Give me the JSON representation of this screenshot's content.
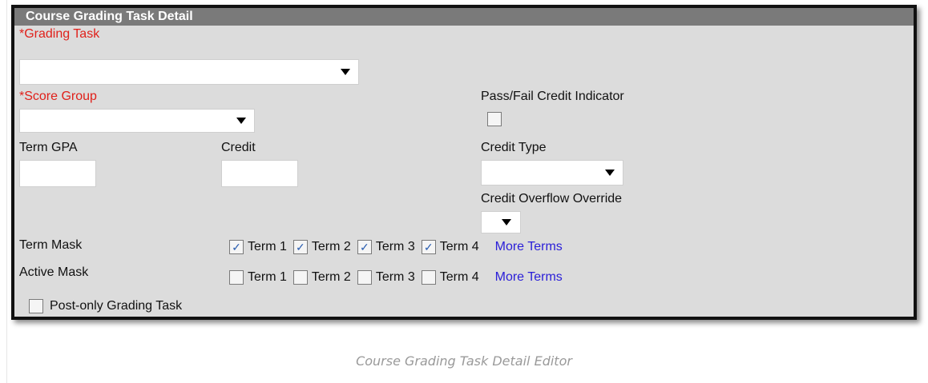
{
  "panel": {
    "title": "Course Grading Task Detail"
  },
  "fields": {
    "grading_task_label": "*Grading Task",
    "grading_task_value": "",
    "score_group_label": "*Score Group",
    "score_group_value": "",
    "pass_fail_label": "Pass/Fail Credit Indicator",
    "pass_fail_checked": false,
    "term_gpa_label": "Term GPA",
    "term_gpa_value": "",
    "credit_label": "Credit",
    "credit_value": "",
    "credit_type_label": "Credit Type",
    "credit_type_value": "",
    "credit_overflow_label": "Credit Overflow Override",
    "credit_overflow_value": ""
  },
  "term_mask": {
    "label": "Term Mask",
    "terms": [
      {
        "label": "Term 1",
        "checked": true
      },
      {
        "label": "Term 2",
        "checked": true
      },
      {
        "label": "Term 3",
        "checked": true
      },
      {
        "label": "Term 4",
        "checked": true
      }
    ],
    "more_label": "More Terms"
  },
  "active_mask": {
    "label": "Active Mask",
    "terms": [
      {
        "label": "Term 1",
        "checked": false
      },
      {
        "label": "Term 2",
        "checked": false
      },
      {
        "label": "Term 3",
        "checked": false
      },
      {
        "label": "Term 4",
        "checked": false
      }
    ],
    "more_label": "More Terms"
  },
  "post_only": {
    "label": "Post-only Grading Task",
    "checked": false
  },
  "caption": "Course Grading Task Detail Editor",
  "colors": {
    "required": "#e0201a",
    "link": "#2a1ed8",
    "header_bg": "#7a7a7a",
    "panel_bg": "#dcdcdc"
  }
}
